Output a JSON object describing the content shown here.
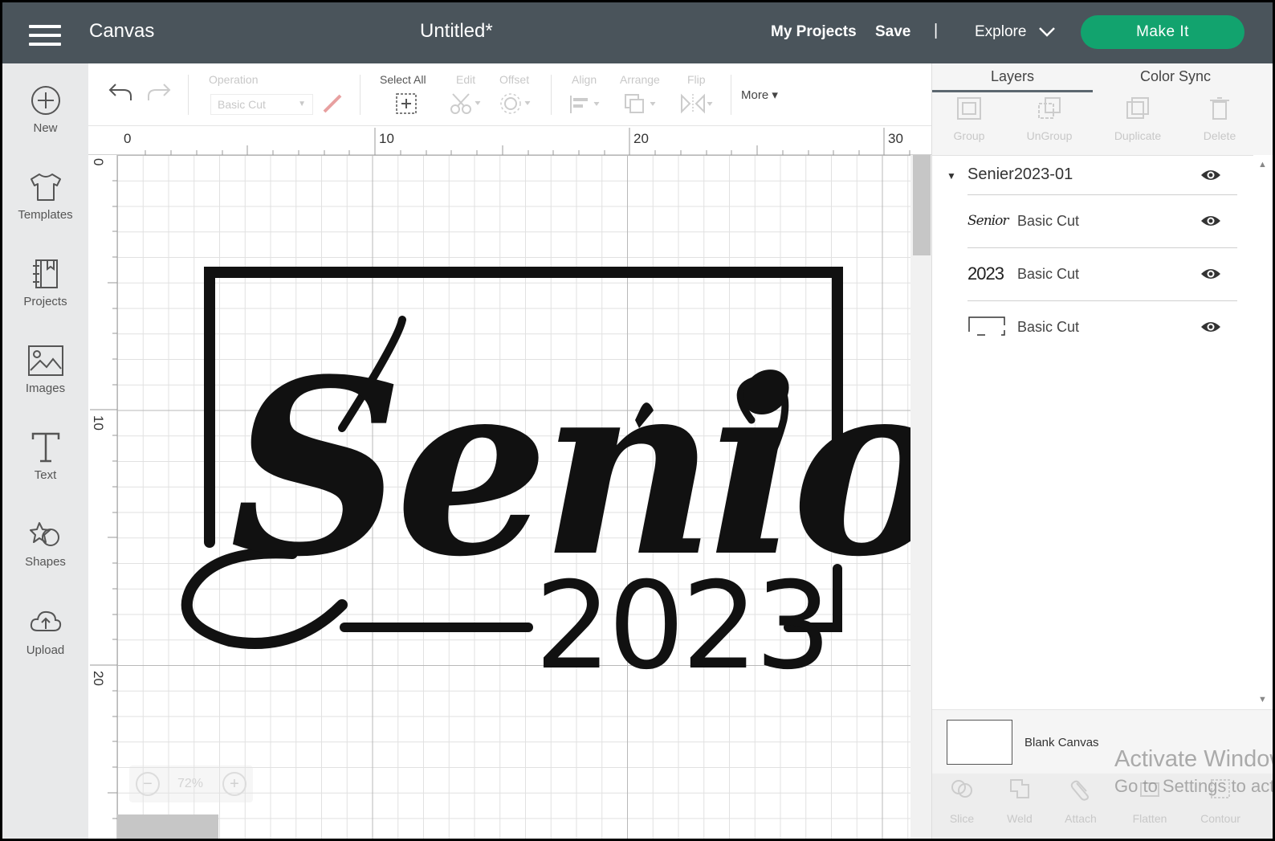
{
  "topbar": {
    "app_name": "Canvas",
    "doc_title": "Untitled*",
    "my_projects": "My Projects",
    "save": "Save",
    "separator": "|",
    "explore": "Explore",
    "make_it": "Make It",
    "make_it_color": "#12a36e",
    "bar_color": "#4a545b"
  },
  "leftbar": {
    "items": [
      {
        "label": "New",
        "icon": "plus-circle-icon"
      },
      {
        "label": "Templates",
        "icon": "tshirt-icon"
      },
      {
        "label": "Projects",
        "icon": "notebook-icon"
      },
      {
        "label": "Images",
        "icon": "image-icon"
      },
      {
        "label": "Text",
        "icon": "text-t-icon"
      },
      {
        "label": "Shapes",
        "icon": "shapes-icon"
      },
      {
        "label": "Upload",
        "icon": "cloud-upload-icon"
      }
    ]
  },
  "toolbar": {
    "operation_label": "Operation",
    "operation_value": "Basic Cut",
    "select_all": "Select All",
    "edit": "Edit",
    "offset": "Offset",
    "align": "Align",
    "arrange": "Arrange",
    "flip": "Flip",
    "more": "More"
  },
  "rulers": {
    "top": [
      "0",
      "10",
      "20",
      "30"
    ],
    "left": [
      "0",
      "10",
      "20"
    ]
  },
  "zoom": {
    "value": "72%"
  },
  "design": {
    "word": "Senior",
    "year": "2023"
  },
  "rightpanel": {
    "tabs": [
      "Layers",
      "Color Sync"
    ],
    "actions": [
      "Group",
      "UnGroup",
      "Duplicate",
      "Delete"
    ],
    "group_name": "Senier2023-01",
    "layers": [
      {
        "thumb_text": "Senior",
        "name": "Basic Cut"
      },
      {
        "thumb_text": "2023",
        "name": "Basic Cut"
      },
      {
        "thumb_text": "",
        "name": "Basic Cut"
      }
    ],
    "blank_canvas": "Blank Canvas",
    "bottom_tools": [
      "Slice",
      "Weld",
      "Attach",
      "Flatten",
      "Contour"
    ]
  },
  "watermark": {
    "line1": "Activate Windows",
    "line2": "Go to Settings to activate Windows."
  }
}
